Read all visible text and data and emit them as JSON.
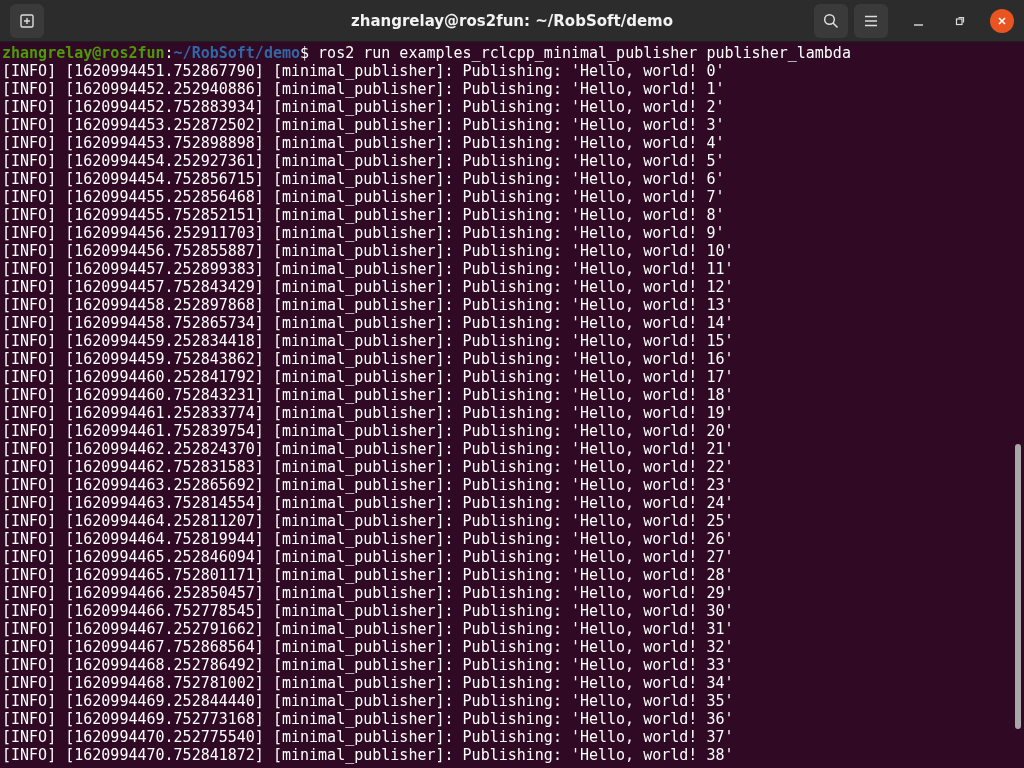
{
  "window": {
    "title": "zhangrelay@ros2fun: ~/RobSoft/demo"
  },
  "prompt": {
    "user_host": "zhangrelay@ros2fun",
    "separator": ":",
    "path": "~/RobSoft/demo",
    "symbol": "$",
    "command": " ros2 run examples_rclcpp_minimal_publisher publisher_lambda"
  },
  "log_lines": [
    "[INFO] [1620994451.752867790] [minimal_publisher]: Publishing: 'Hello, world! 0'",
    "[INFO] [1620994452.252940886] [minimal_publisher]: Publishing: 'Hello, world! 1'",
    "[INFO] [1620994452.752883934] [minimal_publisher]: Publishing: 'Hello, world! 2'",
    "[INFO] [1620994453.252872502] [minimal_publisher]: Publishing: 'Hello, world! 3'",
    "[INFO] [1620994453.752898898] [minimal_publisher]: Publishing: 'Hello, world! 4'",
    "[INFO] [1620994454.252927361] [minimal_publisher]: Publishing: 'Hello, world! 5'",
    "[INFO] [1620994454.752856715] [minimal_publisher]: Publishing: 'Hello, world! 6'",
    "[INFO] [1620994455.252856468] [minimal_publisher]: Publishing: 'Hello, world! 7'",
    "[INFO] [1620994455.752852151] [minimal_publisher]: Publishing: 'Hello, world! 8'",
    "[INFO] [1620994456.252911703] [minimal_publisher]: Publishing: 'Hello, world! 9'",
    "[INFO] [1620994456.752855887] [minimal_publisher]: Publishing: 'Hello, world! 10'",
    "[INFO] [1620994457.252899383] [minimal_publisher]: Publishing: 'Hello, world! 11'",
    "[INFO] [1620994457.752843429] [minimal_publisher]: Publishing: 'Hello, world! 12'",
    "[INFO] [1620994458.252897868] [minimal_publisher]: Publishing: 'Hello, world! 13'",
    "[INFO] [1620994458.752865734] [minimal_publisher]: Publishing: 'Hello, world! 14'",
    "[INFO] [1620994459.252834418] [minimal_publisher]: Publishing: 'Hello, world! 15'",
    "[INFO] [1620994459.752843862] [minimal_publisher]: Publishing: 'Hello, world! 16'",
    "[INFO] [1620994460.252841792] [minimal_publisher]: Publishing: 'Hello, world! 17'",
    "[INFO] [1620994460.752843231] [minimal_publisher]: Publishing: 'Hello, world! 18'",
    "[INFO] [1620994461.252833774] [minimal_publisher]: Publishing: 'Hello, world! 19'",
    "[INFO] [1620994461.752839754] [minimal_publisher]: Publishing: 'Hello, world! 20'",
    "[INFO] [1620994462.252824370] [minimal_publisher]: Publishing: 'Hello, world! 21'",
    "[INFO] [1620994462.752831583] [minimal_publisher]: Publishing: 'Hello, world! 22'",
    "[INFO] [1620994463.252865692] [minimal_publisher]: Publishing: 'Hello, world! 23'",
    "[INFO] [1620994463.752814554] [minimal_publisher]: Publishing: 'Hello, world! 24'",
    "[INFO] [1620994464.252811207] [minimal_publisher]: Publishing: 'Hello, world! 25'",
    "[INFO] [1620994464.752819944] [minimal_publisher]: Publishing: 'Hello, world! 26'",
    "[INFO] [1620994465.252846094] [minimal_publisher]: Publishing: 'Hello, world! 27'",
    "[INFO] [1620994465.752801171] [minimal_publisher]: Publishing: 'Hello, world! 28'",
    "[INFO] [1620994466.252850457] [minimal_publisher]: Publishing: 'Hello, world! 29'",
    "[INFO] [1620994466.752778545] [minimal_publisher]: Publishing: 'Hello, world! 30'",
    "[INFO] [1620994467.252791662] [minimal_publisher]: Publishing: 'Hello, world! 31'",
    "[INFO] [1620994467.752868564] [minimal_publisher]: Publishing: 'Hello, world! 32'",
    "[INFO] [1620994468.252786492] [minimal_publisher]: Publishing: 'Hello, world! 33'",
    "[INFO] [1620994468.752781002] [minimal_publisher]: Publishing: 'Hello, world! 34'",
    "[INFO] [1620994469.252844440] [minimal_publisher]: Publishing: 'Hello, world! 35'",
    "[INFO] [1620994469.752773168] [minimal_publisher]: Publishing: 'Hello, world! 36'",
    "[INFO] [1620994470.252775540] [minimal_publisher]: Publishing: 'Hello, world! 37'",
    "[INFO] [1620994470.752841872] [minimal_publisher]: Publishing: 'Hello, world! 38'"
  ]
}
